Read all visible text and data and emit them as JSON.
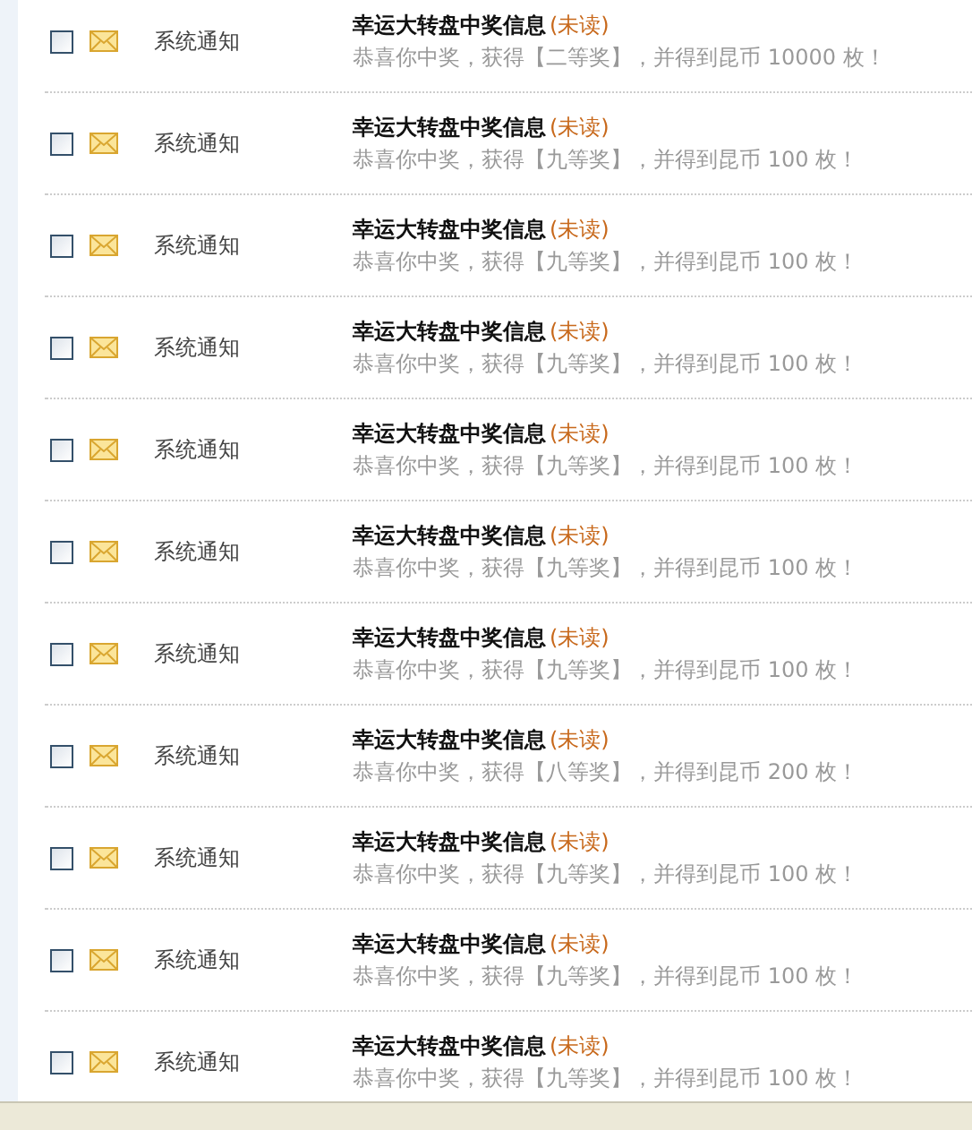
{
  "messages": [
    {
      "checked": false,
      "sender": "系统通知",
      "title": "幸运大转盘中奖信息",
      "status": "(未读)",
      "body": "恭喜你中奖，获得【二等奖】，并得到昆币 10000 枚！"
    },
    {
      "checked": false,
      "sender": "系统通知",
      "title": "幸运大转盘中奖信息",
      "status": "(未读)",
      "body": "恭喜你中奖，获得【九等奖】，并得到昆币 100 枚！"
    },
    {
      "checked": false,
      "sender": "系统通知",
      "title": "幸运大转盘中奖信息",
      "status": "(未读)",
      "body": "恭喜你中奖，获得【九等奖】，并得到昆币 100 枚！"
    },
    {
      "checked": false,
      "sender": "系统通知",
      "title": "幸运大转盘中奖信息",
      "status": "(未读)",
      "body": "恭喜你中奖，获得【九等奖】，并得到昆币 100 枚！"
    },
    {
      "checked": false,
      "sender": "系统通知",
      "title": "幸运大转盘中奖信息",
      "status": "(未读)",
      "body": "恭喜你中奖，获得【九等奖】，并得到昆币 100 枚！"
    },
    {
      "checked": false,
      "sender": "系统通知",
      "title": "幸运大转盘中奖信息",
      "status": "(未读)",
      "body": "恭喜你中奖，获得【九等奖】，并得到昆币 100 枚！"
    },
    {
      "checked": false,
      "sender": "系统通知",
      "title": "幸运大转盘中奖信息",
      "status": "(未读)",
      "body": "恭喜你中奖，获得【九等奖】，并得到昆币 100 枚！"
    },
    {
      "checked": false,
      "sender": "系统通知",
      "title": "幸运大转盘中奖信息",
      "status": "(未读)",
      "body": "恭喜你中奖，获得【八等奖】，并得到昆币 200 枚！"
    },
    {
      "checked": false,
      "sender": "系统通知",
      "title": "幸运大转盘中奖信息",
      "status": "(未读)",
      "body": "恭喜你中奖，获得【九等奖】，并得到昆币 100 枚！"
    },
    {
      "checked": false,
      "sender": "系统通知",
      "title": "幸运大转盘中奖信息",
      "status": "(未读)",
      "body": "恭喜你中奖，获得【九等奖】，并得到昆币 100 枚！"
    },
    {
      "checked": false,
      "sender": "系统通知",
      "title": "幸运大转盘中奖信息",
      "status": "(未读)",
      "body": "恭喜你中奖，获得【九等奖】，并得到昆币 100 枚！"
    }
  ]
}
